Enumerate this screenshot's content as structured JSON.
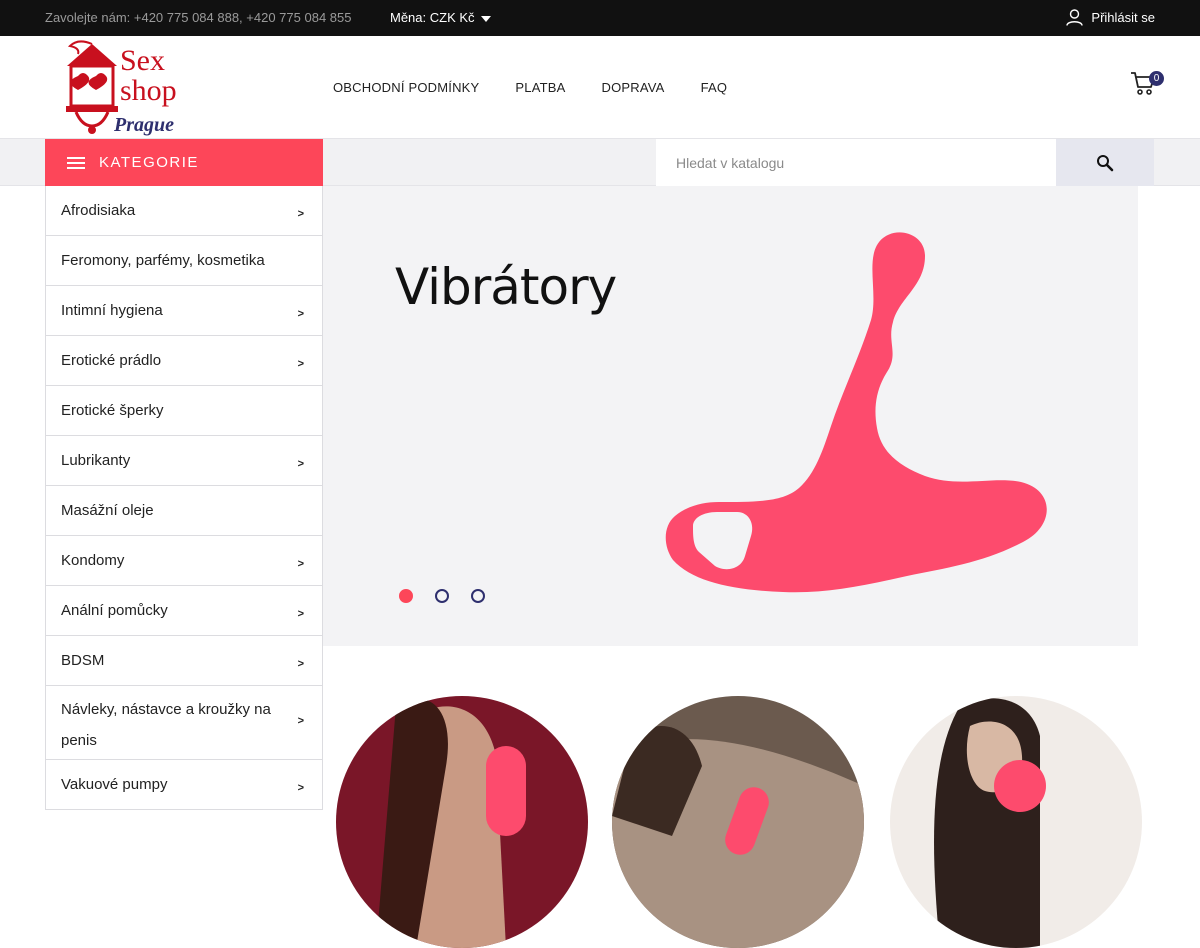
{
  "topbar": {
    "contact": "Zavolejte nám: +420 775 084 888, +420 775 084 855",
    "currency": "Měna: CZK Kč",
    "login": "Přihlásit se"
  },
  "logo": {
    "line1": "Sex",
    "line2": "shop",
    "line3": "Prague"
  },
  "nav": {
    "items": [
      "OBCHODNÍ PODMÍNKY",
      "PLATBA",
      "DOPRAVA",
      "FAQ"
    ]
  },
  "cart": {
    "count": "0"
  },
  "categories_button": "KATEGORIE",
  "search": {
    "placeholder": "Hledat v katalogu"
  },
  "categories": [
    {
      "label": "Afrodisiaka"
    },
    {
      "label": "Feromony, parfémy, kosmetika"
    },
    {
      "label": "Intimní hygiena"
    },
    {
      "label": "Erotické prádlo"
    },
    {
      "label": "Erotické šperky"
    },
    {
      "label": "Lubrikanty"
    },
    {
      "label": "Masážní oleje"
    },
    {
      "label": "Kondomy"
    },
    {
      "label": "Anální pomůcky"
    },
    {
      "label": "BDSM"
    },
    {
      "label": "Návleky, nástavce a kroužky na penis"
    },
    {
      "label": "Vakuové pumpy"
    }
  ],
  "hero": {
    "title": "Vibrátory",
    "slide_count": 3,
    "active_slide": 1
  },
  "colors": {
    "accent": "#fd4659",
    "navy": "#2e2f6e",
    "topbar": "#111111"
  }
}
